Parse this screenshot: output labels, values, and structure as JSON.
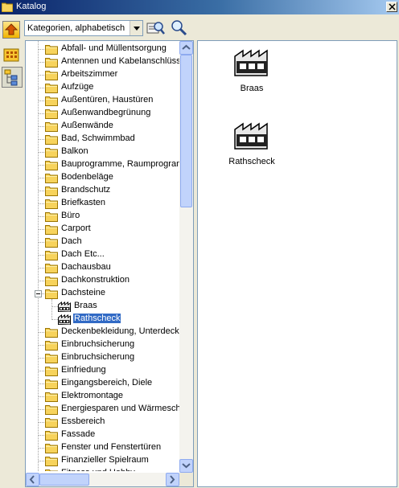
{
  "window": {
    "title": "Katalog"
  },
  "toolbar": {
    "sort_combo_value": "Kategorien, alphabetisch"
  },
  "tree": {
    "items": [
      "Abfall- und Müllentsorgung",
      "Antennen und Kabelanschlüsse",
      "Arbeitszimmer",
      "Aufzüge",
      "Außentüren, Haustüren",
      "Außenwandbegrünung",
      "Außenwände",
      "Bad, Schwimmbad",
      "Balkon",
      "Bauprogramme, Raumprogramme",
      "Bodenbeläge",
      "Brandschutz",
      "Briefkasten",
      "Büro",
      "Carport",
      "Dach",
      "Dach Etc...",
      "Dachausbau",
      "Dachkonstruktion",
      "Dachsteine",
      "Braas",
      "Rathscheck",
      "Deckenbekleidung, Unterdecken",
      "Einbruchsicherung",
      "Einbruchsicherung",
      "Einfriedung",
      "Eingangsbereich, Diele",
      "Elektromontage",
      "Energiesparen und Wärmeschutz",
      "Essbereich",
      "Fassade",
      "Fenster und Fenstertüren",
      "Finanzieller Spielraum",
      "Fitness und Hobby"
    ]
  },
  "content": {
    "items": [
      "Braas",
      "Rathscheck"
    ]
  }
}
